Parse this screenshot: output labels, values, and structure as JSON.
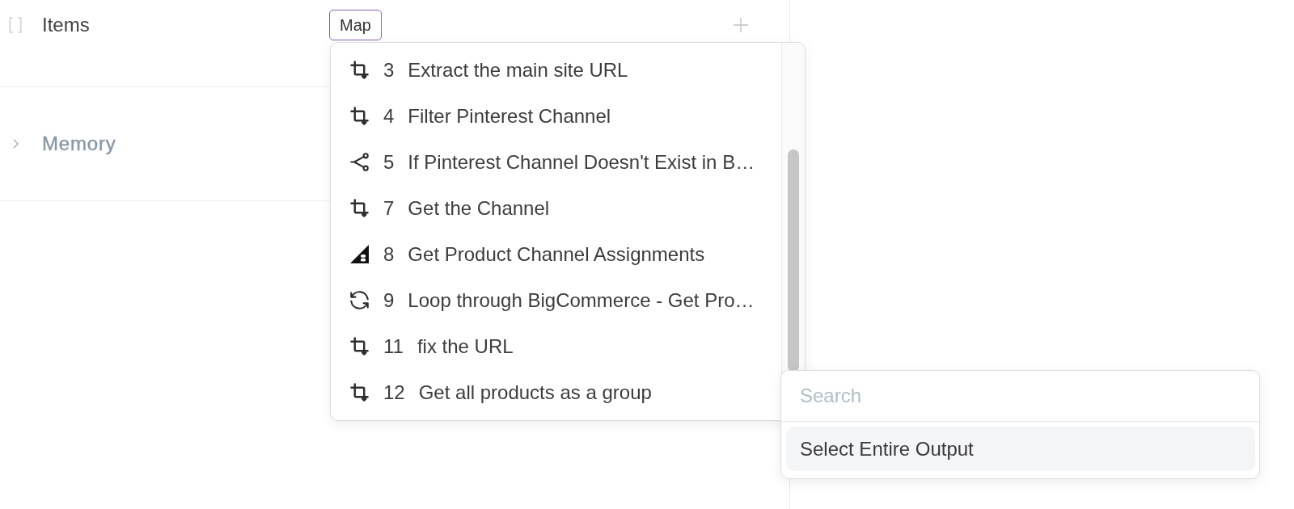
{
  "items_field": {
    "label": "Items",
    "token": "Map"
  },
  "memory_section": {
    "label": "Memory",
    "expanded": false
  },
  "step_menu": {
    "items": [
      {
        "kind": "transform",
        "number": "3",
        "label": "Extract the main site URL",
        "selected": false
      },
      {
        "kind": "transform",
        "number": "4",
        "label": "Filter Pinterest Channel",
        "selected": false
      },
      {
        "kind": "condition",
        "number": "5",
        "label": "If Pinterest Channel Doesn't Exist in B…",
        "selected": false
      },
      {
        "kind": "transform",
        "number": "7",
        "label": "Get the Channel",
        "selected": false
      },
      {
        "kind": "app",
        "number": "8",
        "label": "Get Product Channel Assignments",
        "selected": false
      },
      {
        "kind": "loop",
        "number": "9",
        "label": "Loop through BigCommerce - Get Pro…",
        "selected": false
      },
      {
        "kind": "transform",
        "number": "11",
        "label": "fix the URL",
        "selected": false
      },
      {
        "kind": "transform",
        "number": "12",
        "label": "Get all products as a group",
        "selected": false
      }
    ]
  },
  "output_picker": {
    "search": {
      "placeholder": "Search"
    },
    "options": [
      {
        "label": "Select Entire Output",
        "selected": true
      }
    ]
  }
}
